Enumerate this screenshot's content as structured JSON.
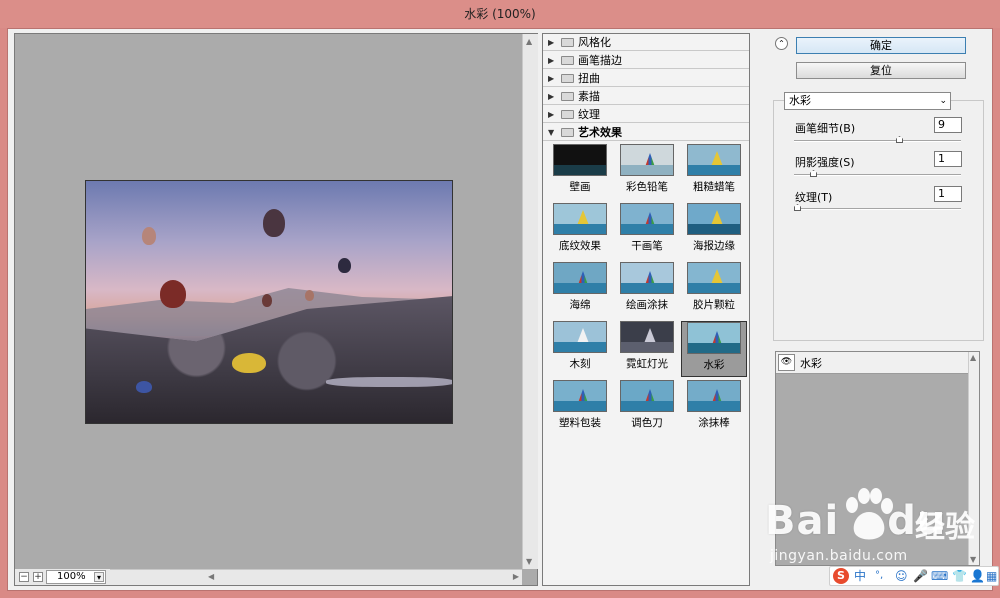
{
  "window": {
    "title": "水彩 (100%)"
  },
  "preview": {
    "zoom_value": "100%",
    "zoom_minus": "−",
    "zoom_plus": "+"
  },
  "gallery": {
    "categories": [
      {
        "label": "风格化",
        "expanded": false
      },
      {
        "label": "画笔描边",
        "expanded": false
      },
      {
        "label": "扭曲",
        "expanded": false
      },
      {
        "label": "素描",
        "expanded": false
      },
      {
        "label": "纹理",
        "expanded": false
      },
      {
        "label": "艺术效果",
        "expanded": true
      }
    ],
    "filters": [
      {
        "label": "壁画"
      },
      {
        "label": "彩色铅笔"
      },
      {
        "label": "粗糙蜡笔"
      },
      {
        "label": "底纹效果"
      },
      {
        "label": "干画笔"
      },
      {
        "label": "海报边缘"
      },
      {
        "label": "海绵"
      },
      {
        "label": "绘画涂抹"
      },
      {
        "label": "胶片颗粒"
      },
      {
        "label": "木刻"
      },
      {
        "label": "霓虹灯光"
      },
      {
        "label": "水彩"
      },
      {
        "label": "塑料包装"
      },
      {
        "label": "调色刀"
      },
      {
        "label": "涂抹棒"
      }
    ],
    "selected_filter": "水彩"
  },
  "controls": {
    "ok_label": "确定",
    "reset_label": "复位",
    "filter_select": "水彩",
    "params": [
      {
        "label": "画笔细节(B)",
        "value": "9",
        "level": 0.64
      },
      {
        "label": "阴影强度(S)",
        "value": "1",
        "level": 0.1
      },
      {
        "label": "纹理(T)",
        "value": "1",
        "level": 0.0
      }
    ]
  },
  "layers": {
    "items": [
      {
        "name": "水彩"
      }
    ]
  },
  "watermark": {
    "brand": "Bai",
    "brand2": "du",
    "jingyan": "经验",
    "url": "jingyan.baidu.com"
  },
  "ime": {
    "s_logo": "S",
    "zh": "中",
    "punct": "°,"
  },
  "colors": {
    "titlebar": "#db8e89",
    "panel": "#f0f0f0",
    "canvas": "#ababab",
    "accent": "#3c7fb1"
  }
}
